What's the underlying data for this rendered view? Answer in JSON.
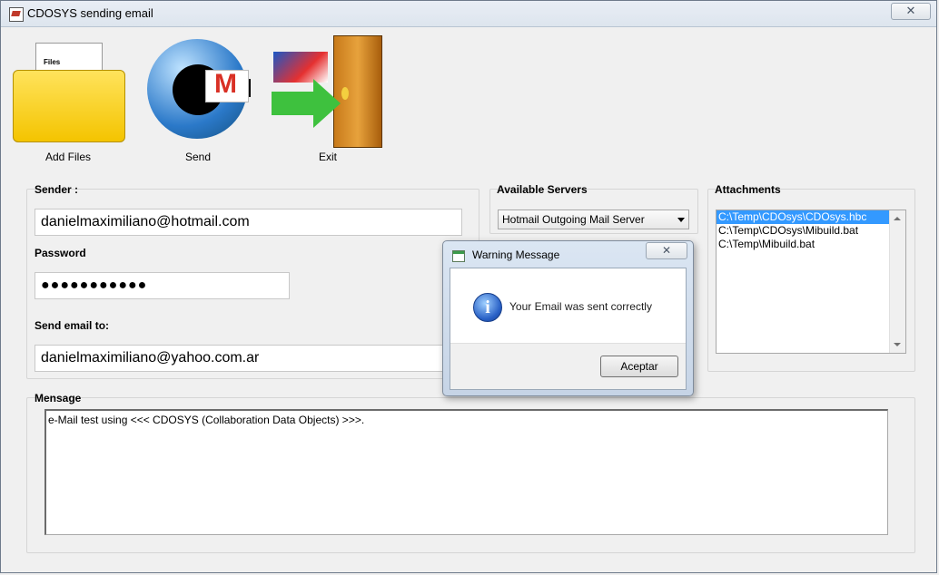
{
  "window": {
    "title": "CDOSYS sending email",
    "close_glyph": "✕"
  },
  "toolbar": [
    {
      "label": "Add Files",
      "icon": "files-folder-icon"
    },
    {
      "label": "Send",
      "icon": "gmail-send-icon"
    },
    {
      "label": "Exit",
      "icon": "exit-door-icon"
    }
  ],
  "sender": {
    "label": "Sender :",
    "value": "danielmaximiliano@hotmail.com"
  },
  "password": {
    "label": "Password",
    "value": "●●●●●●●●●●●"
  },
  "send_to": {
    "label": "Send email to:",
    "value": "danielmaximiliano@yahoo.com.ar"
  },
  "servers": {
    "label": "Available Servers",
    "selected": "Hotmail Outgoing Mail Server"
  },
  "attachments": {
    "label": "Attachments",
    "items": [
      "C:\\Temp\\CDOsys\\CDOsys.hbc",
      "C:\\Temp\\CDOsys\\Mibuild.bat",
      "C:\\Temp\\Mibuild.bat"
    ],
    "selected_index": 0
  },
  "message": {
    "label": "Mensage",
    "value": "e-Mail test using <<< CDOSYS (Collaboration Data Objects) >>>."
  },
  "dialog": {
    "title": "Warning Message",
    "close_glyph": "✕",
    "message": "Your Email was sent correctly",
    "button": "Aceptar",
    "icon": "info-icon",
    "icon_glyph": "i"
  }
}
